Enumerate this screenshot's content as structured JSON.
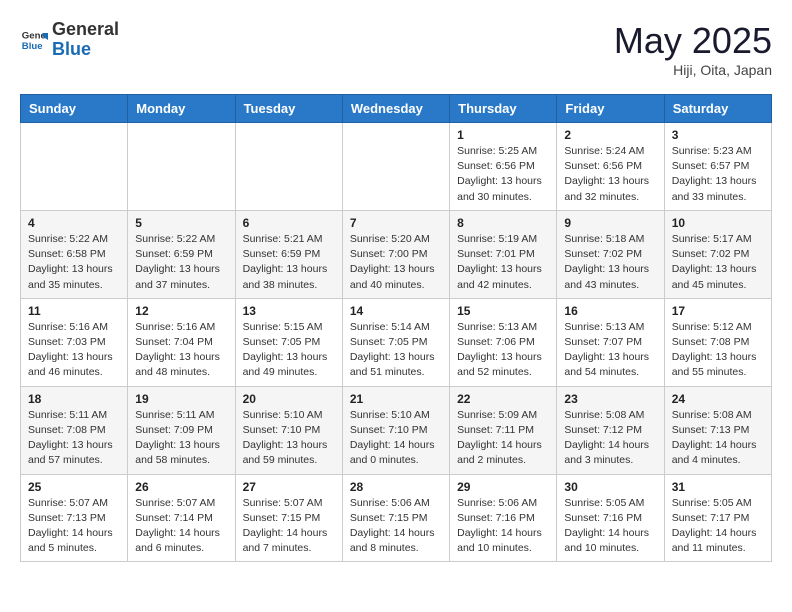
{
  "header": {
    "logo_general": "General",
    "logo_blue": "Blue",
    "month": "May 2025",
    "location": "Hiji, Oita, Japan"
  },
  "weekdays": [
    "Sunday",
    "Monday",
    "Tuesday",
    "Wednesday",
    "Thursday",
    "Friday",
    "Saturday"
  ],
  "weeks": [
    [
      {
        "day": "",
        "sunrise": "",
        "sunset": "",
        "daylight": ""
      },
      {
        "day": "",
        "sunrise": "",
        "sunset": "",
        "daylight": ""
      },
      {
        "day": "",
        "sunrise": "",
        "sunset": "",
        "daylight": ""
      },
      {
        "day": "",
        "sunrise": "",
        "sunset": "",
        "daylight": ""
      },
      {
        "day": "1",
        "sunrise": "Sunrise: 5:25 AM",
        "sunset": "Sunset: 6:56 PM",
        "daylight": "Daylight: 13 hours and 30 minutes."
      },
      {
        "day": "2",
        "sunrise": "Sunrise: 5:24 AM",
        "sunset": "Sunset: 6:56 PM",
        "daylight": "Daylight: 13 hours and 32 minutes."
      },
      {
        "day": "3",
        "sunrise": "Sunrise: 5:23 AM",
        "sunset": "Sunset: 6:57 PM",
        "daylight": "Daylight: 13 hours and 33 minutes."
      }
    ],
    [
      {
        "day": "4",
        "sunrise": "Sunrise: 5:22 AM",
        "sunset": "Sunset: 6:58 PM",
        "daylight": "Daylight: 13 hours and 35 minutes."
      },
      {
        "day": "5",
        "sunrise": "Sunrise: 5:22 AM",
        "sunset": "Sunset: 6:59 PM",
        "daylight": "Daylight: 13 hours and 37 minutes."
      },
      {
        "day": "6",
        "sunrise": "Sunrise: 5:21 AM",
        "sunset": "Sunset: 6:59 PM",
        "daylight": "Daylight: 13 hours and 38 minutes."
      },
      {
        "day": "7",
        "sunrise": "Sunrise: 5:20 AM",
        "sunset": "Sunset: 7:00 PM",
        "daylight": "Daylight: 13 hours and 40 minutes."
      },
      {
        "day": "8",
        "sunrise": "Sunrise: 5:19 AM",
        "sunset": "Sunset: 7:01 PM",
        "daylight": "Daylight: 13 hours and 42 minutes."
      },
      {
        "day": "9",
        "sunrise": "Sunrise: 5:18 AM",
        "sunset": "Sunset: 7:02 PM",
        "daylight": "Daylight: 13 hours and 43 minutes."
      },
      {
        "day": "10",
        "sunrise": "Sunrise: 5:17 AM",
        "sunset": "Sunset: 7:02 PM",
        "daylight": "Daylight: 13 hours and 45 minutes."
      }
    ],
    [
      {
        "day": "11",
        "sunrise": "Sunrise: 5:16 AM",
        "sunset": "Sunset: 7:03 PM",
        "daylight": "Daylight: 13 hours and 46 minutes."
      },
      {
        "day": "12",
        "sunrise": "Sunrise: 5:16 AM",
        "sunset": "Sunset: 7:04 PM",
        "daylight": "Daylight: 13 hours and 48 minutes."
      },
      {
        "day": "13",
        "sunrise": "Sunrise: 5:15 AM",
        "sunset": "Sunset: 7:05 PM",
        "daylight": "Daylight: 13 hours and 49 minutes."
      },
      {
        "day": "14",
        "sunrise": "Sunrise: 5:14 AM",
        "sunset": "Sunset: 7:05 PM",
        "daylight": "Daylight: 13 hours and 51 minutes."
      },
      {
        "day": "15",
        "sunrise": "Sunrise: 5:13 AM",
        "sunset": "Sunset: 7:06 PM",
        "daylight": "Daylight: 13 hours and 52 minutes."
      },
      {
        "day": "16",
        "sunrise": "Sunrise: 5:13 AM",
        "sunset": "Sunset: 7:07 PM",
        "daylight": "Daylight: 13 hours and 54 minutes."
      },
      {
        "day": "17",
        "sunrise": "Sunrise: 5:12 AM",
        "sunset": "Sunset: 7:08 PM",
        "daylight": "Daylight: 13 hours and 55 minutes."
      }
    ],
    [
      {
        "day": "18",
        "sunrise": "Sunrise: 5:11 AM",
        "sunset": "Sunset: 7:08 PM",
        "daylight": "Daylight: 13 hours and 57 minutes."
      },
      {
        "day": "19",
        "sunrise": "Sunrise: 5:11 AM",
        "sunset": "Sunset: 7:09 PM",
        "daylight": "Daylight: 13 hours and 58 minutes."
      },
      {
        "day": "20",
        "sunrise": "Sunrise: 5:10 AM",
        "sunset": "Sunset: 7:10 PM",
        "daylight": "Daylight: 13 hours and 59 minutes."
      },
      {
        "day": "21",
        "sunrise": "Sunrise: 5:10 AM",
        "sunset": "Sunset: 7:10 PM",
        "daylight": "Daylight: 14 hours and 0 minutes."
      },
      {
        "day": "22",
        "sunrise": "Sunrise: 5:09 AM",
        "sunset": "Sunset: 7:11 PM",
        "daylight": "Daylight: 14 hours and 2 minutes."
      },
      {
        "day": "23",
        "sunrise": "Sunrise: 5:08 AM",
        "sunset": "Sunset: 7:12 PM",
        "daylight": "Daylight: 14 hours and 3 minutes."
      },
      {
        "day": "24",
        "sunrise": "Sunrise: 5:08 AM",
        "sunset": "Sunset: 7:13 PM",
        "daylight": "Daylight: 14 hours and 4 minutes."
      }
    ],
    [
      {
        "day": "25",
        "sunrise": "Sunrise: 5:07 AM",
        "sunset": "Sunset: 7:13 PM",
        "daylight": "Daylight: 14 hours and 5 minutes."
      },
      {
        "day": "26",
        "sunrise": "Sunrise: 5:07 AM",
        "sunset": "Sunset: 7:14 PM",
        "daylight": "Daylight: 14 hours and 6 minutes."
      },
      {
        "day": "27",
        "sunrise": "Sunrise: 5:07 AM",
        "sunset": "Sunset: 7:15 PM",
        "daylight": "Daylight: 14 hours and 7 minutes."
      },
      {
        "day": "28",
        "sunrise": "Sunrise: 5:06 AM",
        "sunset": "Sunset: 7:15 PM",
        "daylight": "Daylight: 14 hours and 8 minutes."
      },
      {
        "day": "29",
        "sunrise": "Sunrise: 5:06 AM",
        "sunset": "Sunset: 7:16 PM",
        "daylight": "Daylight: 14 hours and 10 minutes."
      },
      {
        "day": "30",
        "sunrise": "Sunrise: 5:05 AM",
        "sunset": "Sunset: 7:16 PM",
        "daylight": "Daylight: 14 hours and 10 minutes."
      },
      {
        "day": "31",
        "sunrise": "Sunrise: 5:05 AM",
        "sunset": "Sunset: 7:17 PM",
        "daylight": "Daylight: 14 hours and 11 minutes."
      }
    ]
  ]
}
